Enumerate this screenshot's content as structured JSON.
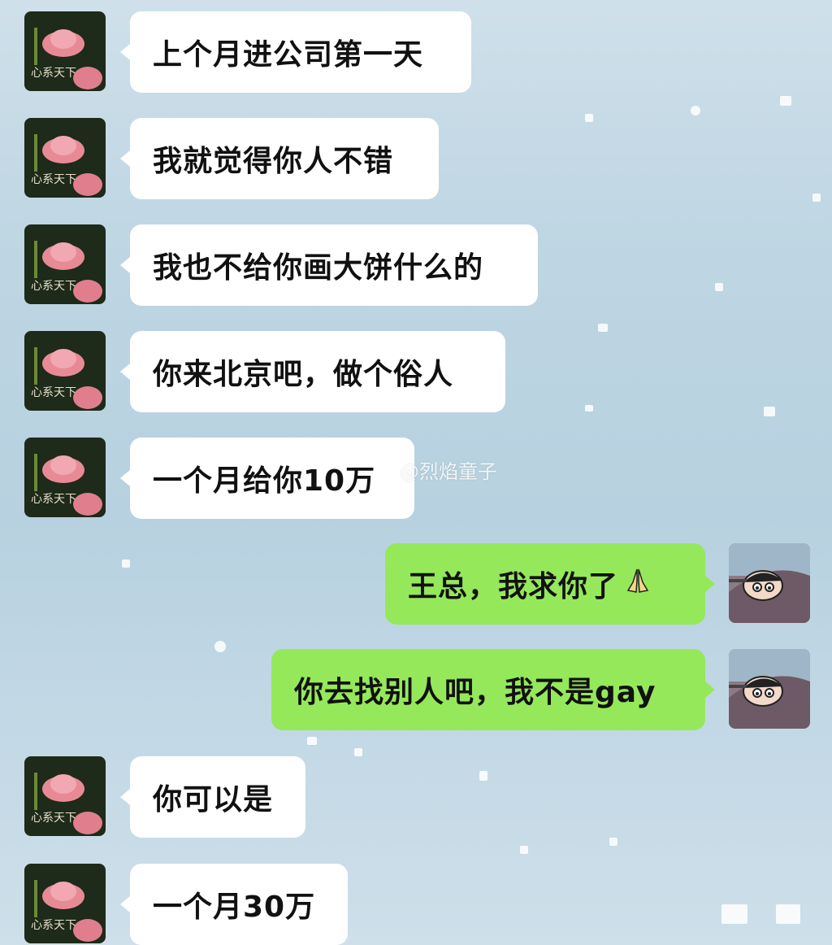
{
  "conversation": {
    "messages": [
      {
        "side": "left",
        "text": "上个月进公司第一天"
      },
      {
        "side": "left",
        "text": "我就觉得你人不错"
      },
      {
        "side": "left",
        "text": "我也不给你画大饼什么的"
      },
      {
        "side": "left",
        "text": "你来北京吧，做个俗人"
      },
      {
        "side": "left",
        "text": "一个月给你10万"
      },
      {
        "side": "right",
        "text": "王总，我求你了",
        "emoji": "praying-hands"
      },
      {
        "side": "right",
        "text": "你去找别人吧，我不是gay"
      },
      {
        "side": "left",
        "text": "你可以是"
      },
      {
        "side": "left",
        "text": "一个月30万"
      }
    ]
  },
  "avatars": {
    "left": {
      "icon": "lotus-icon",
      "caption": "心系天下"
    },
    "right": {
      "icon": "cartoon-boy-icon"
    }
  },
  "watermark": {
    "text": "@烈焰童子",
    "icon": "weibo-icon"
  },
  "colors": {
    "incoming_bubble": "#ffffff",
    "outgoing_bubble": "#95e85a",
    "background": "#bfd6e3"
  }
}
